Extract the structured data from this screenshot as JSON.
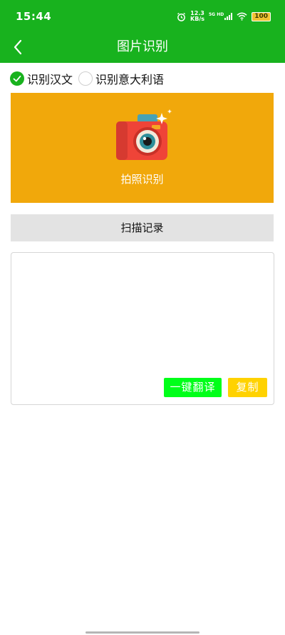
{
  "status_bar": {
    "time": "15:44",
    "net_speed_value": "12.3",
    "net_speed_unit": "KB/s",
    "network": "5G HD",
    "battery": "100",
    "icons": [
      "alarm-icon",
      "signal-icon",
      "wifi-icon",
      "battery-icon"
    ]
  },
  "header": {
    "title": "图片识别",
    "back_icon": "chevron-left-icon"
  },
  "options": {
    "chinese": {
      "label": "识别汉文",
      "selected": true
    },
    "italian": {
      "label": "识别意大利语",
      "selected": false
    }
  },
  "photo": {
    "label": "拍照识别",
    "icon": "camera-icon"
  },
  "history": {
    "label": "扫描记录"
  },
  "result": {
    "text": "",
    "translate_label": "一键翻译",
    "copy_label": "复制"
  },
  "colors": {
    "primary_green": "#18b21e",
    "photo_panel": "#f1a80b",
    "translate_button": "#00ff19",
    "copy_button": "#ffd200"
  }
}
